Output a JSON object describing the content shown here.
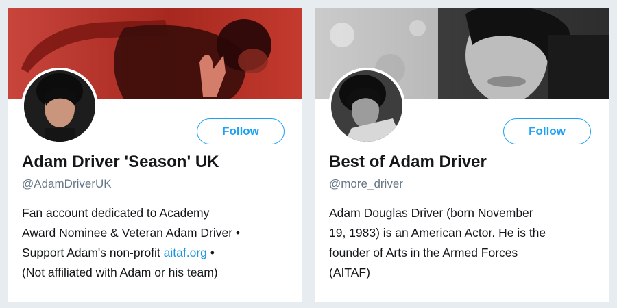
{
  "cards": [
    {
      "name": "Adam Driver 'Season' UK",
      "handle": "@AdamDriverUK",
      "follow_label": "Follow",
      "bio": {
        "line1": "Fan account dedicated to Academy",
        "line2": "Award Nominee & Veteran Adam Driver •",
        "line3_prefix": "Support Adam's non-profit ",
        "line3_link": "aitaf.org",
        "line3_suffix": " •",
        "line4": "(Not affiliated with Adam or his team)"
      },
      "banner_color": "#b3302a"
    },
    {
      "name": "Best of Adam Driver",
      "handle": "@more_driver",
      "follow_label": "Follow",
      "bio": {
        "line1": "Adam Douglas Driver (born November",
        "line2": "19, 1983) is an American Actor. He is the",
        "line3": "founder of Arts in the Armed Forces",
        "line4": "(AITAF)"
      },
      "banner_color": "#3a3a3a"
    }
  ],
  "colors": {
    "accent": "#1da1f2",
    "link": "#1b95e0",
    "text": "#14171a",
    "muted": "#657786",
    "background": "#e6ecf0"
  }
}
